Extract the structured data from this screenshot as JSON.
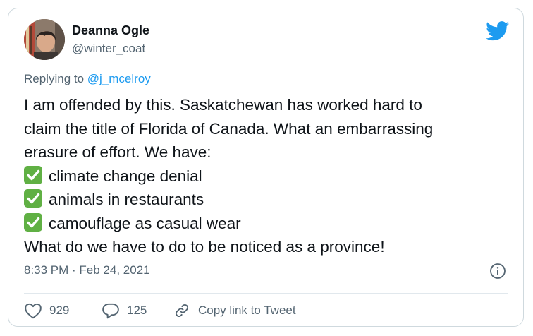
{
  "tweet": {
    "author_name": "Deanna Ogle",
    "author_handle": "@winter_coat",
    "replying_prefix": "Replying to ",
    "replying_to": "@j_mcelroy",
    "text_lines": [
      "I am offended by this. Saskatchewan has worked hard to",
      "claim the title of Florida of Canada. What an embarrassing",
      "erasure of effort. We have:"
    ],
    "checklist": [
      "climate change denial",
      "animals in restaurants",
      "camouflage as casual wear"
    ],
    "closing_line": "What do we have to do to be noticed as a province!",
    "timestamp": "8:33 PM · Feb 24, 2021"
  },
  "actions": {
    "likes": "929",
    "replies": "125",
    "copy_link": "Copy link to Tweet"
  },
  "icons": {
    "brand": "twitter-bird-icon",
    "check": "check-mark-button-icon",
    "info": "info-icon",
    "like": "heart-icon",
    "reply": "speech-bubble-icon",
    "link": "link-icon"
  },
  "colors": {
    "twitter_blue": "#1d9bf0",
    "text_primary": "#0f1419",
    "text_secondary": "#536471",
    "check_green": "#60b044",
    "border": "#cfd9de"
  }
}
